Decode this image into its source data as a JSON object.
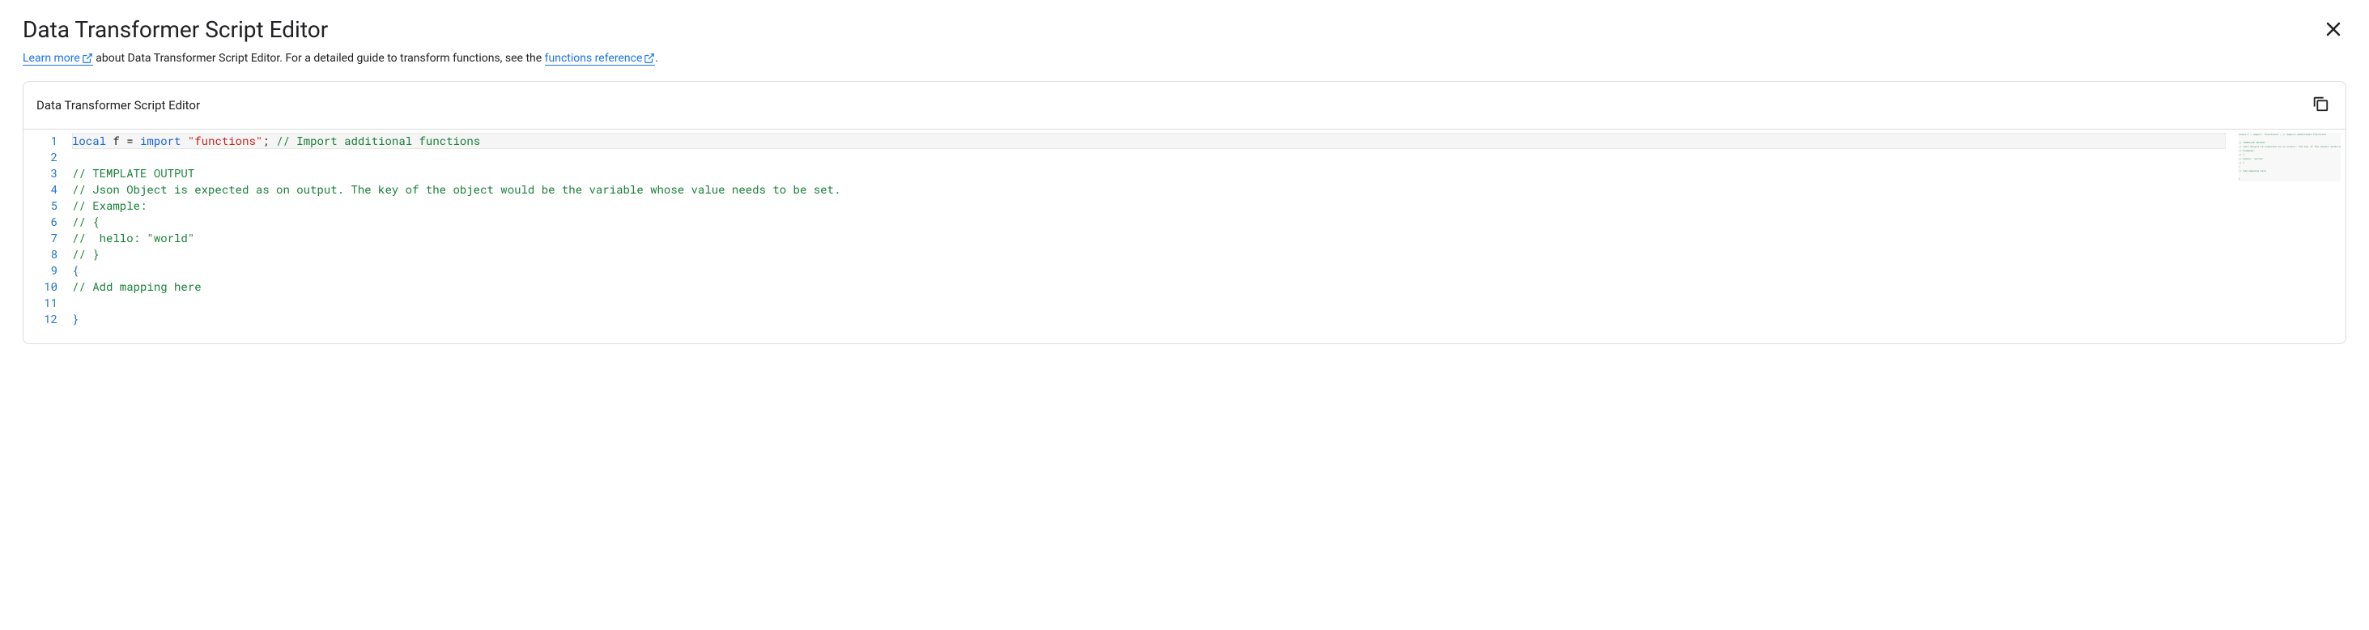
{
  "header": {
    "title": "Data Transformer Script Editor"
  },
  "description": {
    "learn_more_label": "Learn more",
    "text_middle": " about Data Transformer Script Editor. For a detailed guide to transform functions, see the ",
    "functions_ref_label": "functions reference",
    "text_end": "."
  },
  "editor": {
    "panel_title": "Data Transformer Script Editor",
    "lines": [
      {
        "num": "1",
        "highlighted": true,
        "tokens": [
          {
            "cls": "tok-keyword",
            "text": "local"
          },
          {
            "cls": "tok-ident",
            "text": " f = "
          },
          {
            "cls": "tok-keyword",
            "text": "import"
          },
          {
            "cls": "tok-ident",
            "text": " "
          },
          {
            "cls": "tok-string",
            "text": "\"functions\""
          },
          {
            "cls": "tok-ident",
            "text": "; "
          },
          {
            "cls": "tok-comment",
            "text": "// Import additional functions"
          }
        ]
      },
      {
        "num": "2",
        "tokens": []
      },
      {
        "num": "3",
        "tokens": [
          {
            "cls": "tok-comment",
            "text": "// TEMPLATE OUTPUT"
          }
        ]
      },
      {
        "num": "4",
        "tokens": [
          {
            "cls": "tok-comment",
            "text": "// Json Object is expected as on output. The key of the object would be the variable whose value needs to be set."
          }
        ]
      },
      {
        "num": "5",
        "tokens": [
          {
            "cls": "tok-comment",
            "text": "// Example:"
          }
        ]
      },
      {
        "num": "6",
        "tokens": [
          {
            "cls": "tok-comment",
            "text": "// {"
          }
        ]
      },
      {
        "num": "7",
        "tokens": [
          {
            "cls": "tok-comment",
            "text": "//  hello: \"world\""
          }
        ]
      },
      {
        "num": "8",
        "tokens": [
          {
            "cls": "tok-comment",
            "text": "// }"
          }
        ]
      },
      {
        "num": "9",
        "tokens": [
          {
            "cls": "tok-punct",
            "text": "{"
          }
        ]
      },
      {
        "num": "10",
        "tokens": [
          {
            "cls": "tok-comment",
            "text": "// Add mapping here"
          }
        ]
      },
      {
        "num": "11",
        "tokens": []
      },
      {
        "num": "12",
        "tokens": [
          {
            "cls": "tok-punct",
            "text": "}"
          }
        ]
      }
    ]
  }
}
